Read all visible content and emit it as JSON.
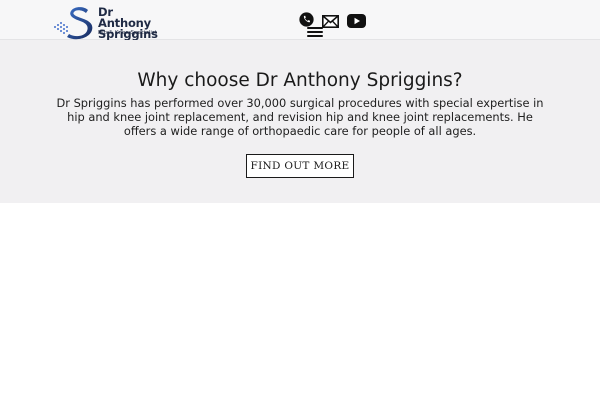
{
  "header": {
    "logo": {
      "name_line1": "Dr Anthony",
      "name_line2": "Spriggins",
      "tagline": "Hip & Knee Specialist"
    },
    "icons": [
      "phone-icon",
      "mail-icon",
      "youtube-icon"
    ],
    "menu_icon": "hamburger-menu-icon"
  },
  "hero": {
    "title": "Why choose Dr Anthony Spriggins?",
    "description": "Dr Spriggins has performed over 30,000 surgical procedures with special expertise in hip and knee joint replacement, and revision hip and knee joint replacements. He offers a wide range of orthopaedic care for people of all ages.",
    "button_label": "FIND OUT MORE"
  },
  "colors": {
    "header_bg": "#f7f7f8",
    "hero_bg": "#f1f0f2",
    "logo_blue": "#1f4fa0",
    "logo_navy": "#1f2a44"
  }
}
